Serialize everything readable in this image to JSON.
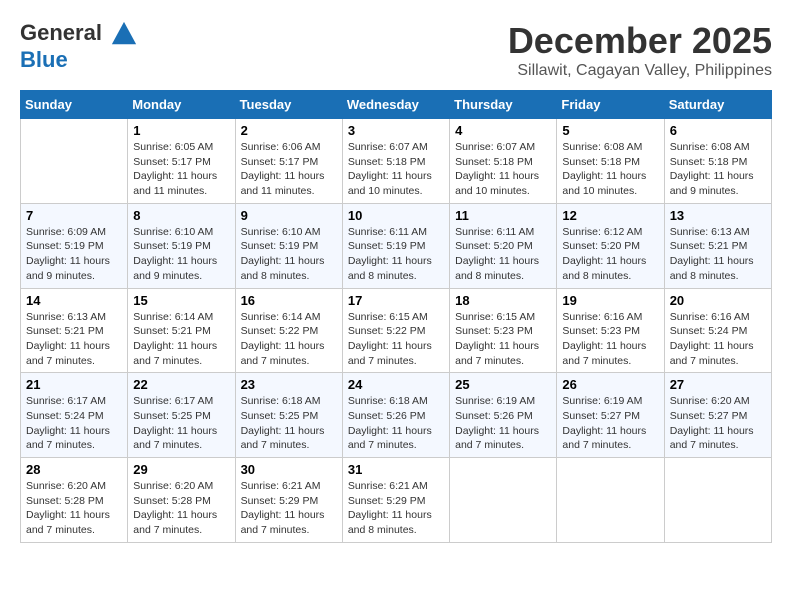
{
  "header": {
    "logo_line1": "General",
    "logo_line2": "Blue",
    "month": "December 2025",
    "location": "Sillawit, Cagayan Valley, Philippines"
  },
  "days_of_week": [
    "Sunday",
    "Monday",
    "Tuesday",
    "Wednesday",
    "Thursday",
    "Friday",
    "Saturday"
  ],
  "weeks": [
    [
      {
        "day": "",
        "sunrise": "",
        "sunset": "",
        "daylight": ""
      },
      {
        "day": "1",
        "sunrise": "6:05 AM",
        "sunset": "5:17 PM",
        "daylight": "11 hours and 11 minutes."
      },
      {
        "day": "2",
        "sunrise": "6:06 AM",
        "sunset": "5:17 PM",
        "daylight": "11 hours and 11 minutes."
      },
      {
        "day": "3",
        "sunrise": "6:07 AM",
        "sunset": "5:18 PM",
        "daylight": "11 hours and 10 minutes."
      },
      {
        "day": "4",
        "sunrise": "6:07 AM",
        "sunset": "5:18 PM",
        "daylight": "11 hours and 10 minutes."
      },
      {
        "day": "5",
        "sunrise": "6:08 AM",
        "sunset": "5:18 PM",
        "daylight": "11 hours and 10 minutes."
      },
      {
        "day": "6",
        "sunrise": "6:08 AM",
        "sunset": "5:18 PM",
        "daylight": "11 hours and 9 minutes."
      }
    ],
    [
      {
        "day": "7",
        "sunrise": "6:09 AM",
        "sunset": "5:19 PM",
        "daylight": "11 hours and 9 minutes."
      },
      {
        "day": "8",
        "sunrise": "6:10 AM",
        "sunset": "5:19 PM",
        "daylight": "11 hours and 9 minutes."
      },
      {
        "day": "9",
        "sunrise": "6:10 AM",
        "sunset": "5:19 PM",
        "daylight": "11 hours and 8 minutes."
      },
      {
        "day": "10",
        "sunrise": "6:11 AM",
        "sunset": "5:19 PM",
        "daylight": "11 hours and 8 minutes."
      },
      {
        "day": "11",
        "sunrise": "6:11 AM",
        "sunset": "5:20 PM",
        "daylight": "11 hours and 8 minutes."
      },
      {
        "day": "12",
        "sunrise": "6:12 AM",
        "sunset": "5:20 PM",
        "daylight": "11 hours and 8 minutes."
      },
      {
        "day": "13",
        "sunrise": "6:13 AM",
        "sunset": "5:21 PM",
        "daylight": "11 hours and 8 minutes."
      }
    ],
    [
      {
        "day": "14",
        "sunrise": "6:13 AM",
        "sunset": "5:21 PM",
        "daylight": "11 hours and 7 minutes."
      },
      {
        "day": "15",
        "sunrise": "6:14 AM",
        "sunset": "5:21 PM",
        "daylight": "11 hours and 7 minutes."
      },
      {
        "day": "16",
        "sunrise": "6:14 AM",
        "sunset": "5:22 PM",
        "daylight": "11 hours and 7 minutes."
      },
      {
        "day": "17",
        "sunrise": "6:15 AM",
        "sunset": "5:22 PM",
        "daylight": "11 hours and 7 minutes."
      },
      {
        "day": "18",
        "sunrise": "6:15 AM",
        "sunset": "5:23 PM",
        "daylight": "11 hours and 7 minutes."
      },
      {
        "day": "19",
        "sunrise": "6:16 AM",
        "sunset": "5:23 PM",
        "daylight": "11 hours and 7 minutes."
      },
      {
        "day": "20",
        "sunrise": "6:16 AM",
        "sunset": "5:24 PM",
        "daylight": "11 hours and 7 minutes."
      }
    ],
    [
      {
        "day": "21",
        "sunrise": "6:17 AM",
        "sunset": "5:24 PM",
        "daylight": "11 hours and 7 minutes."
      },
      {
        "day": "22",
        "sunrise": "6:17 AM",
        "sunset": "5:25 PM",
        "daylight": "11 hours and 7 minutes."
      },
      {
        "day": "23",
        "sunrise": "6:18 AM",
        "sunset": "5:25 PM",
        "daylight": "11 hours and 7 minutes."
      },
      {
        "day": "24",
        "sunrise": "6:18 AM",
        "sunset": "5:26 PM",
        "daylight": "11 hours and 7 minutes."
      },
      {
        "day": "25",
        "sunrise": "6:19 AM",
        "sunset": "5:26 PM",
        "daylight": "11 hours and 7 minutes."
      },
      {
        "day": "26",
        "sunrise": "6:19 AM",
        "sunset": "5:27 PM",
        "daylight": "11 hours and 7 minutes."
      },
      {
        "day": "27",
        "sunrise": "6:20 AM",
        "sunset": "5:27 PM",
        "daylight": "11 hours and 7 minutes."
      }
    ],
    [
      {
        "day": "28",
        "sunrise": "6:20 AM",
        "sunset": "5:28 PM",
        "daylight": "11 hours and 7 minutes."
      },
      {
        "day": "29",
        "sunrise": "6:20 AM",
        "sunset": "5:28 PM",
        "daylight": "11 hours and 7 minutes."
      },
      {
        "day": "30",
        "sunrise": "6:21 AM",
        "sunset": "5:29 PM",
        "daylight": "11 hours and 7 minutes."
      },
      {
        "day": "31",
        "sunrise": "6:21 AM",
        "sunset": "5:29 PM",
        "daylight": "11 hours and 8 minutes."
      },
      {
        "day": "",
        "sunrise": "",
        "sunset": "",
        "daylight": ""
      },
      {
        "day": "",
        "sunrise": "",
        "sunset": "",
        "daylight": ""
      },
      {
        "day": "",
        "sunrise": "",
        "sunset": "",
        "daylight": ""
      }
    ]
  ],
  "labels": {
    "sunrise_prefix": "Sunrise: ",
    "sunset_prefix": "Sunset: ",
    "daylight_prefix": "Daylight: "
  }
}
